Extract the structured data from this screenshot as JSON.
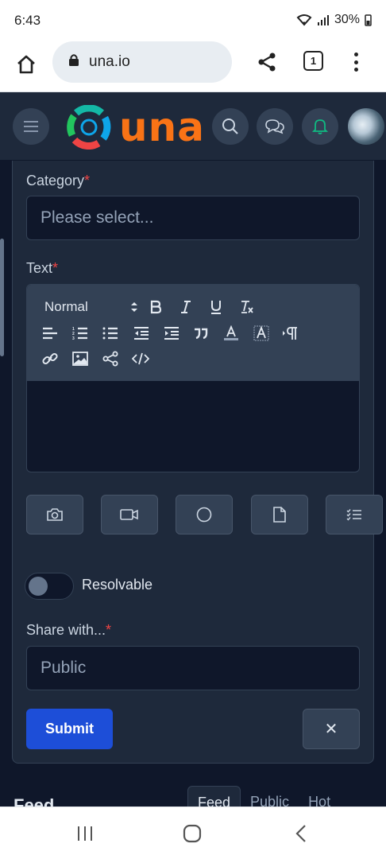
{
  "status_bar": {
    "time": "6:43",
    "battery": "30%"
  },
  "browser": {
    "url": "una.io",
    "tab_count": "1"
  },
  "site": {
    "logo_text": "una"
  },
  "form": {
    "category_label": "Category",
    "required_mark": "*",
    "category_placeholder": "Please select...",
    "text_label": "Text",
    "editor": {
      "format_select": "Normal"
    },
    "toggle_label": "Resolvable",
    "share_label": "Share with...",
    "share_value": "Public",
    "submit_label": "Submit",
    "cancel_label": "✕"
  },
  "feed": {
    "title": "Feed",
    "tabs": [
      "Feed",
      "Public",
      "Hot"
    ]
  },
  "colors": {
    "accent": "#1d4ed8",
    "brand_orange": "#f97316",
    "brand_teal": "#14b8a6",
    "brand_blue": "#0ea5e9",
    "brand_red": "#ef4444"
  }
}
